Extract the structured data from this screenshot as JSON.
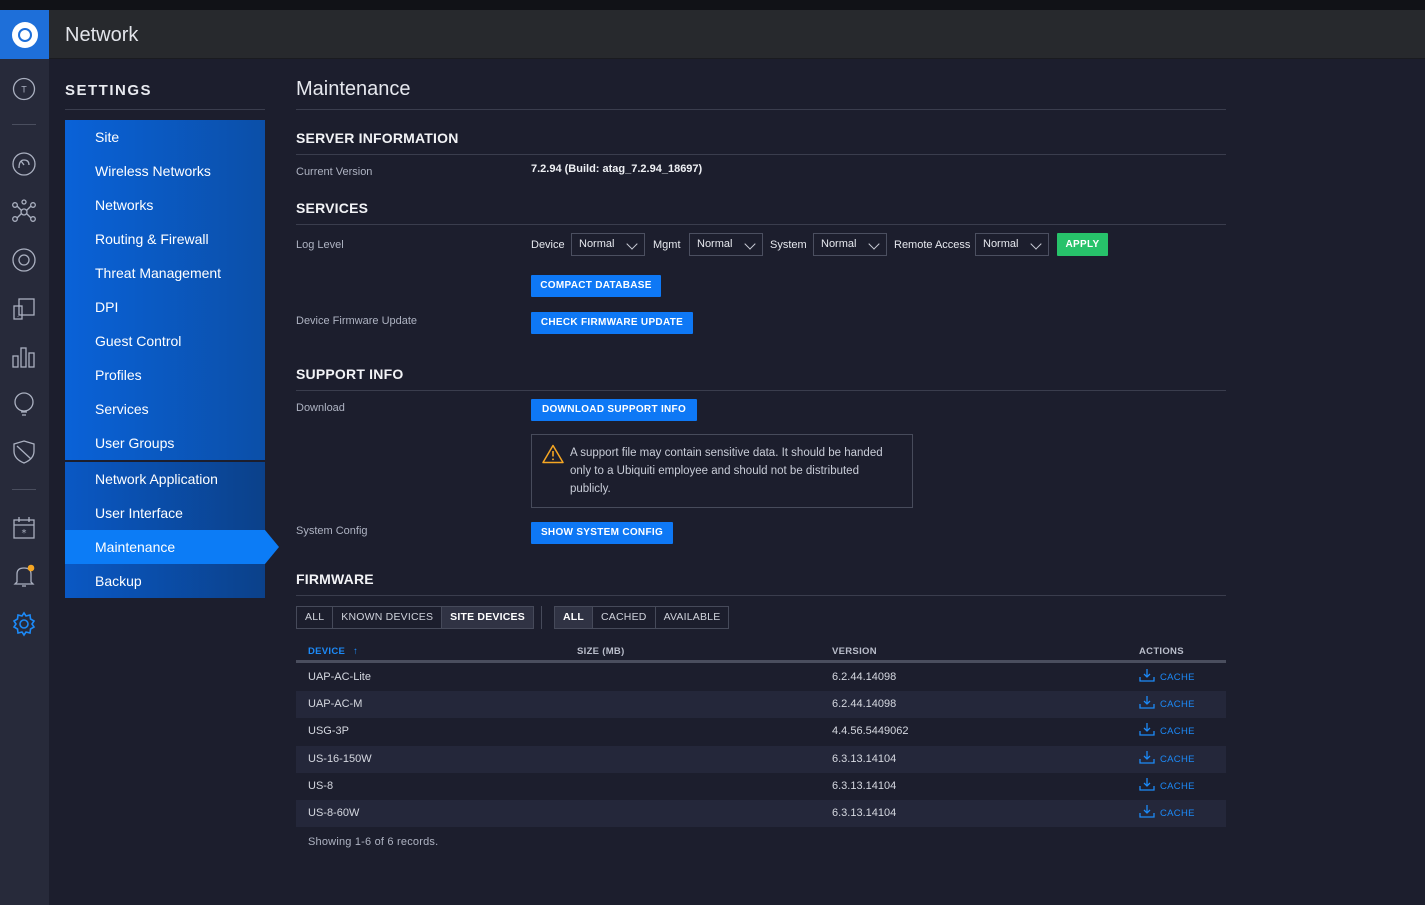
{
  "app": {
    "title": "Network"
  },
  "settings": {
    "title": "SETTINGS",
    "group1": [
      "Site",
      "Wireless Networks",
      "Networks",
      "Routing & Firewall",
      "Threat Management",
      "DPI",
      "Guest Control",
      "Profiles",
      "Services",
      "User Groups"
    ],
    "group2": [
      "Network Application",
      "User Interface",
      "Maintenance",
      "Backup"
    ],
    "active": "Maintenance"
  },
  "rail": {
    "avatar_letter": "T",
    "icons": [
      "dashboard-icon",
      "topology-icon",
      "devices-icon",
      "clients-icon",
      "statistics-icon",
      "insights-icon",
      "shield-icon",
      "events-icon",
      "alerts-icon",
      "settings-icon"
    ],
    "accent": "#f5a623"
  },
  "page": {
    "title": "Maintenance",
    "server": {
      "title": "SERVER INFORMATION",
      "version_label": "Current Version",
      "version_value": "7.2.94 (Build: atag_7.2.94_18697)"
    },
    "services": {
      "title": "SERVICES",
      "log_level_label": "Log Level",
      "device_label": "Device",
      "device_value": "Normal",
      "mgmt_label": "Mgmt",
      "mgmt_value": "Normal",
      "system_label": "System",
      "system_value": "Normal",
      "remote_label": "Remote Access",
      "remote_value": "Normal",
      "apply": "APPLY",
      "compact": "COMPACT DATABASE",
      "fw_label": "Device Firmware Update",
      "check_fw": "CHECK FIRMWARE UPDATE"
    },
    "support": {
      "title": "SUPPORT INFO",
      "download_label": "Download",
      "download_btn": "DOWNLOAD SUPPORT INFO",
      "warning": "A support file may contain sensitive data. It should be handed only to a Ubiquiti employee and should not be distributed publicly.",
      "sysconfig_label": "System Config",
      "sysconfig_btn": "SHOW SYSTEM CONFIG"
    },
    "firmware": {
      "title": "FIRMWARE",
      "filter1": [
        "ALL",
        "KNOWN DEVICES",
        "SITE DEVICES"
      ],
      "filter1_active": "SITE DEVICES",
      "filter2": [
        "ALL",
        "CACHED",
        "AVAILABLE"
      ],
      "filter2_active": "ALL",
      "columns": {
        "device": "DEVICE",
        "size": "SIZE (MB)",
        "version": "VERSION",
        "actions": "ACTIONS"
      },
      "rows": [
        {
          "device": "UAP-AC-Lite",
          "size": "",
          "version": "6.2.44.14098",
          "action": "CACHE"
        },
        {
          "device": "UAP-AC-M",
          "size": "",
          "version": "6.2.44.14098",
          "action": "CACHE"
        },
        {
          "device": "USG-3P",
          "size": "",
          "version": "4.4.56.5449062",
          "action": "CACHE"
        },
        {
          "device": "US-16-150W",
          "size": "",
          "version": "6.3.13.14104",
          "action": "CACHE"
        },
        {
          "device": "US-8",
          "size": "",
          "version": "6.3.13.14104",
          "action": "CACHE"
        },
        {
          "device": "US-8-60W",
          "size": "",
          "version": "6.3.13.14104",
          "action": "CACHE"
        }
      ],
      "footer": "Showing 1-6 of 6 records."
    }
  }
}
